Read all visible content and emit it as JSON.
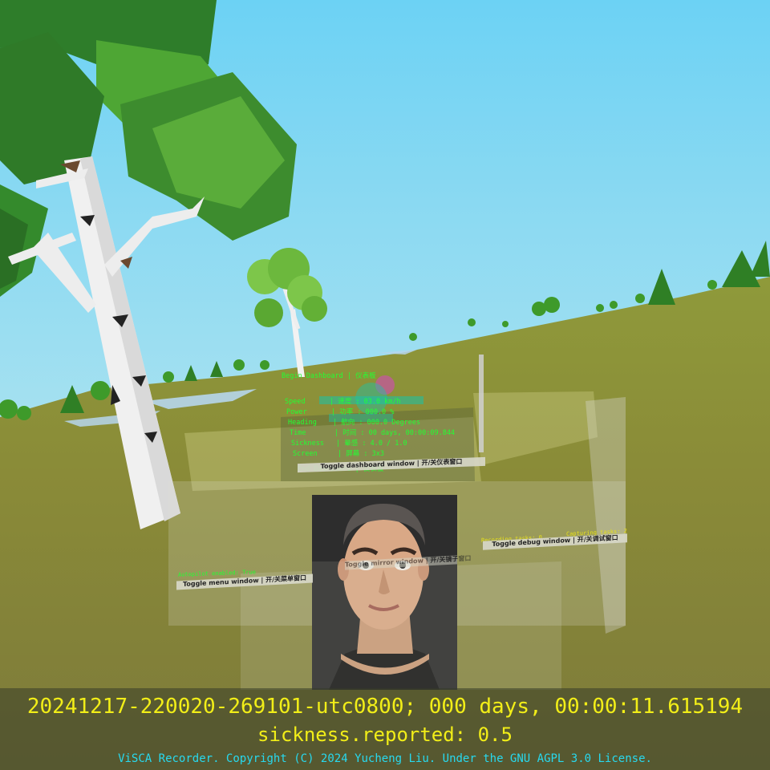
{
  "dashboard": {
    "begin": "Begin Dashboard | 仪表板",
    "rows": [
      {
        "label": "Speed",
        "value": "| 速度 : 03.0 km/h"
      },
      {
        "label": "Power",
        "value": "| 功率 : 000.0 %"
      },
      {
        "label": "Heading",
        "value": "| 航向 : 000.0 Degrees"
      },
      {
        "label": "Time",
        "value": "| 时间 : 00 days, 00:00:09.844"
      },
      {
        "label": "Sickness",
        "value": "| 晕感 : 4.0 / 1.0"
      },
      {
        "label": "Screen",
        "value": "| 屏幕 : 3x3"
      }
    ],
    "end": "End Dashboard | 仪表板",
    "toggle": "Toggle dashboard window | 开/关仪表窗口"
  },
  "menu": {
    "status": "Autopilot enabled: True",
    "toggle": "Toggle menu window | 开/关菜单窗口"
  },
  "mirror": {
    "toggle": "Toggle mirror window | 开/关镜子窗口"
  },
  "debug": {
    "recording": "Recording tasks: 0",
    "capturing": "Capturing tasks: 2",
    "toggle": "Toggle debug window | 开/关调试窗口"
  },
  "footer": {
    "timestamp": "20241217-220020-269101-utc0800; 000 days, 00:00:11.615194",
    "sickness": "sickness.reported: 0.5",
    "copyright": "ViSCA Recorder. Copyright (C) 2024 Yucheng Liu. Under the GNU AGPL 3.0 License."
  },
  "colors": {
    "sky": "#6fd0f2",
    "ground": "#8a8a3a",
    "hud_green": "#22ff33",
    "hud_yellow": "#f2ee18",
    "hud_cyan": "#27d9ef"
  }
}
